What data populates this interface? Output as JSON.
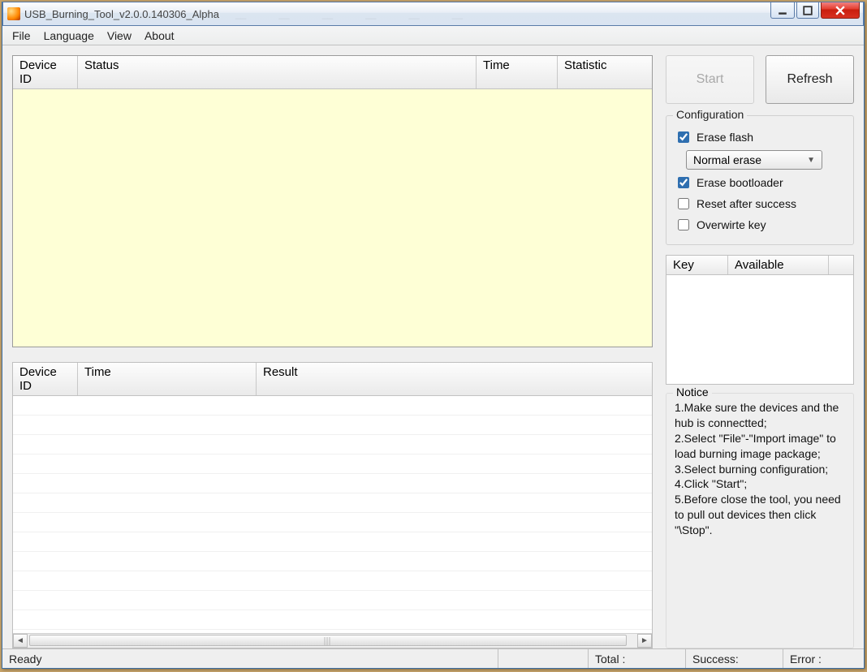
{
  "window": {
    "title": "USB_Burning_Tool_v2.0.0.140306_Alpha"
  },
  "menu": {
    "file": "File",
    "language": "Language",
    "view": "View",
    "about": "About"
  },
  "table1": {
    "headers": {
      "device_id": "Device ID",
      "status": "Status",
      "time": "Time",
      "statistic": "Statistic"
    }
  },
  "table2": {
    "headers": {
      "device_id": "Device ID",
      "time": "Time",
      "result": "Result"
    }
  },
  "buttons": {
    "start": "Start",
    "refresh": "Refresh"
  },
  "config": {
    "legend": "Configuration",
    "erase_flash": {
      "label": "Erase flash",
      "checked": true
    },
    "erase_mode": {
      "selected": "Normal erase"
    },
    "erase_bootloader": {
      "label": "Erase bootloader",
      "checked": true
    },
    "reset_after_success": {
      "label": "Reset after success",
      "checked": false
    },
    "overwrite_key": {
      "label": "Overwirte key",
      "checked": false
    }
  },
  "keytable": {
    "headers": {
      "key": "Key",
      "available": "Available"
    }
  },
  "notice": {
    "legend": "Notice",
    "text": "1.Make sure the devices and the hub is connectted;\n2.Select \"File\"-\"Import image\" to load burning image package;\n3.Select burning configuration;\n4.Click \"Start\";\n5.Before close the tool, you need to pull out devices then click \"\\Stop\"."
  },
  "status": {
    "ready": "Ready",
    "total_label": "Total :",
    "success_label": "Success:",
    "error_label": "Error :"
  }
}
